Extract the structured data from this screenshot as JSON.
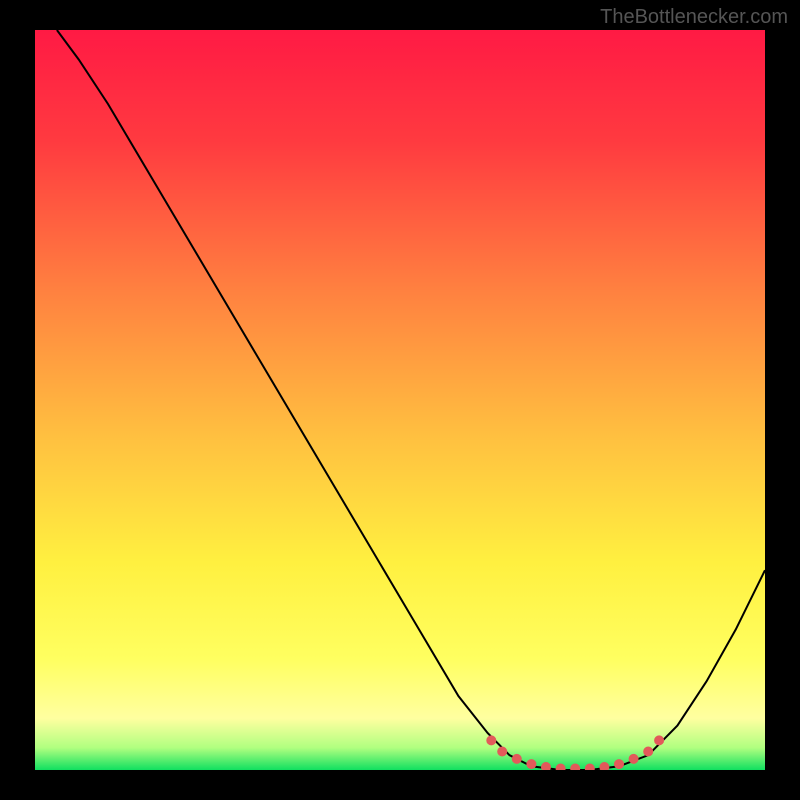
{
  "watermark": "TheBottlenecker.com",
  "chart_data": {
    "type": "line",
    "title": "",
    "xlabel": "",
    "ylabel": "",
    "xlim": [
      0,
      100
    ],
    "ylim": [
      0,
      100
    ],
    "background": {
      "type": "vertical_gradient",
      "stops": [
        {
          "offset": 0,
          "color": "#ff1a44"
        },
        {
          "offset": 15,
          "color": "#ff3a40"
        },
        {
          "offset": 35,
          "color": "#ff8040"
        },
        {
          "offset": 55,
          "color": "#ffc040"
        },
        {
          "offset": 72,
          "color": "#fff040"
        },
        {
          "offset": 85,
          "color": "#ffff60"
        },
        {
          "offset": 93,
          "color": "#ffffa0"
        },
        {
          "offset": 97,
          "color": "#b0ff80"
        },
        {
          "offset": 100,
          "color": "#10e060"
        }
      ]
    },
    "series": [
      {
        "name": "curve",
        "type": "line",
        "color": "#000000",
        "width": 2,
        "points": [
          {
            "x": 3,
            "y": 100
          },
          {
            "x": 6,
            "y": 96
          },
          {
            "x": 10,
            "y": 90
          },
          {
            "x": 16,
            "y": 80
          },
          {
            "x": 22,
            "y": 70
          },
          {
            "x": 28,
            "y": 60
          },
          {
            "x": 34,
            "y": 50
          },
          {
            "x": 40,
            "y": 40
          },
          {
            "x": 46,
            "y": 30
          },
          {
            "x": 52,
            "y": 20
          },
          {
            "x": 58,
            "y": 10
          },
          {
            "x": 62,
            "y": 5
          },
          {
            "x": 65,
            "y": 2
          },
          {
            "x": 68,
            "y": 0.5
          },
          {
            "x": 72,
            "y": 0
          },
          {
            "x": 76,
            "y": 0
          },
          {
            "x": 80,
            "y": 0.5
          },
          {
            "x": 84,
            "y": 2
          },
          {
            "x": 88,
            "y": 6
          },
          {
            "x": 92,
            "y": 12
          },
          {
            "x": 96,
            "y": 19
          },
          {
            "x": 100,
            "y": 27
          }
        ]
      },
      {
        "name": "markers",
        "type": "scatter",
        "color": "#e25a5a",
        "radius": 5,
        "points": [
          {
            "x": 62.5,
            "y": 4
          },
          {
            "x": 64,
            "y": 2.5
          },
          {
            "x": 66,
            "y": 1.5
          },
          {
            "x": 68,
            "y": 0.8
          },
          {
            "x": 70,
            "y": 0.4
          },
          {
            "x": 72,
            "y": 0.2
          },
          {
            "x": 74,
            "y": 0.2
          },
          {
            "x": 76,
            "y": 0.2
          },
          {
            "x": 78,
            "y": 0.4
          },
          {
            "x": 80,
            "y": 0.8
          },
          {
            "x": 82,
            "y": 1.5
          },
          {
            "x": 84,
            "y": 2.5
          },
          {
            "x": 85.5,
            "y": 4
          }
        ]
      }
    ]
  }
}
